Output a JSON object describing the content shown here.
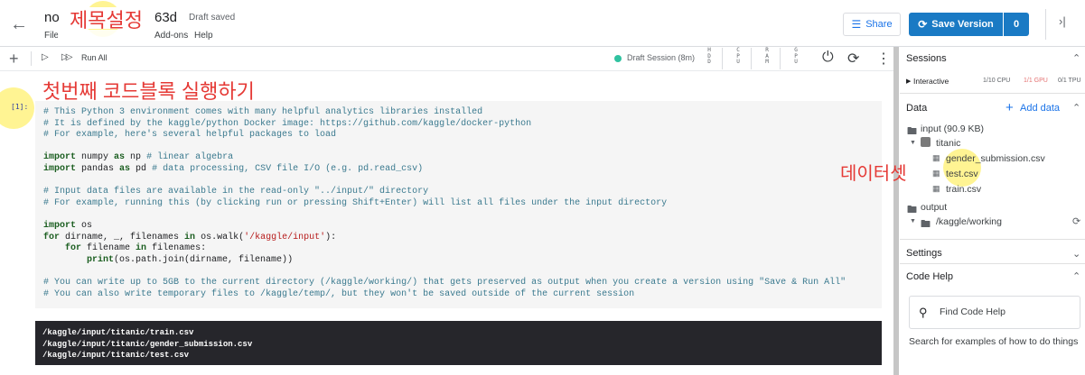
{
  "header": {
    "back_icon": "arrow-left-icon",
    "title_start": "no",
    "title_end": "63d",
    "title_annotation": "제목설정",
    "draft_status": "Draft saved",
    "menu": [
      "File",
      "Add-ons",
      "Help"
    ],
    "share_label": "Share",
    "save_version_label": "Save Version",
    "save_version_count": "0"
  },
  "toolbar": {
    "run_all_label": "Run All",
    "session_label": "Draft Session (8m)",
    "meters": [
      "HDD",
      "CPU",
      "RAM",
      "GPU"
    ]
  },
  "notebook": {
    "cell_annotation": "첫번째 코드블록 실행하기",
    "execution_count": "[1]:",
    "code_lines": [
      [
        [
          "cm",
          "# This Python 3 environment comes with many helpful analytics libraries installed"
        ]
      ],
      [
        [
          "cm",
          "# It is defined by the kaggle/python Docker image: https://github.com/kaggle/docker-python"
        ]
      ],
      [
        [
          "cm",
          "# For example, here's several helpful packages to load"
        ]
      ],
      [],
      [
        [
          "kw",
          "import"
        ],
        [
          "",
          "numpy "
        ],
        [
          "kw",
          "as"
        ],
        [
          "",
          "np "
        ],
        [
          "cm",
          "# linear algebra"
        ]
      ],
      [
        [
          "kw",
          "import"
        ],
        [
          "",
          "pandas "
        ],
        [
          "kw",
          "as"
        ],
        [
          "",
          "pd "
        ],
        [
          "cm",
          "# data processing, CSV file I/O (e.g. pd.read_csv)"
        ]
      ],
      [],
      [
        [
          "cm",
          "# Input data files are available in the read-only \"../input/\" directory"
        ]
      ],
      [
        [
          "cm",
          "# For example, running this (by clicking run or pressing Shift+Enter) will list all files under the input directory"
        ]
      ],
      [],
      [
        [
          "kw",
          "import"
        ],
        [
          "",
          "os"
        ]
      ],
      [
        [
          "kw",
          "for"
        ],
        [
          "",
          "dirname, _, filenames "
        ],
        [
          "kw",
          "in"
        ],
        [
          "",
          "os.walk("
        ],
        [
          "st",
          "'/kaggle/input'"
        ],
        [
          "",
          "):"
        ]
      ],
      [
        [
          "",
          "    "
        ],
        [
          "kw",
          "for"
        ],
        [
          "",
          "filename "
        ],
        [
          "kw",
          "in"
        ],
        [
          "",
          "filenames:"
        ]
      ],
      [
        [
          "",
          "        "
        ],
        [
          "kw",
          "print"
        ],
        [
          "",
          "(os.path.join(dirname, filename))"
        ]
      ],
      [],
      [
        [
          "cm",
          "# You can write up to 5GB to the current directory (/kaggle/working/) that gets preserved as output when you create a version using \"Save & Run All\""
        ]
      ],
      [
        [
          "cm",
          "# You can also write temporary files to /kaggle/temp/, but they won't be saved outside of the current session"
        ]
      ]
    ],
    "output_lines": [
      "/kaggle/input/titanic/train.csv",
      "/kaggle/input/titanic/gender_submission.csv",
      "/kaggle/input/titanic/test.csv"
    ],
    "data_annotation": "데이터셋"
  },
  "panel": {
    "sessions_title": "Sessions",
    "interactive_label": "Interactive",
    "cpu_usage": "1/10 CPU",
    "gpu_usage": "1/1 GPU",
    "tpu_usage": "0/1 TPU",
    "data_title": "Data",
    "add_data_label": "Add data",
    "input_label": "input (90.9 KB)",
    "dataset_name": "titanic",
    "files": [
      "gender_submission.csv",
      "test.csv",
      "train.csv"
    ],
    "output_label": "output",
    "working_label": "/kaggle/working",
    "settings_title": "Settings",
    "code_help_title": "Code Help",
    "find_placeholder": "Find Code Help",
    "code_help_hint": "Search for examples of how to do things",
    "colors": {
      "accent": "#1a7ac4",
      "link": "#1a73e8",
      "gpu_warn": "#e57373"
    }
  }
}
